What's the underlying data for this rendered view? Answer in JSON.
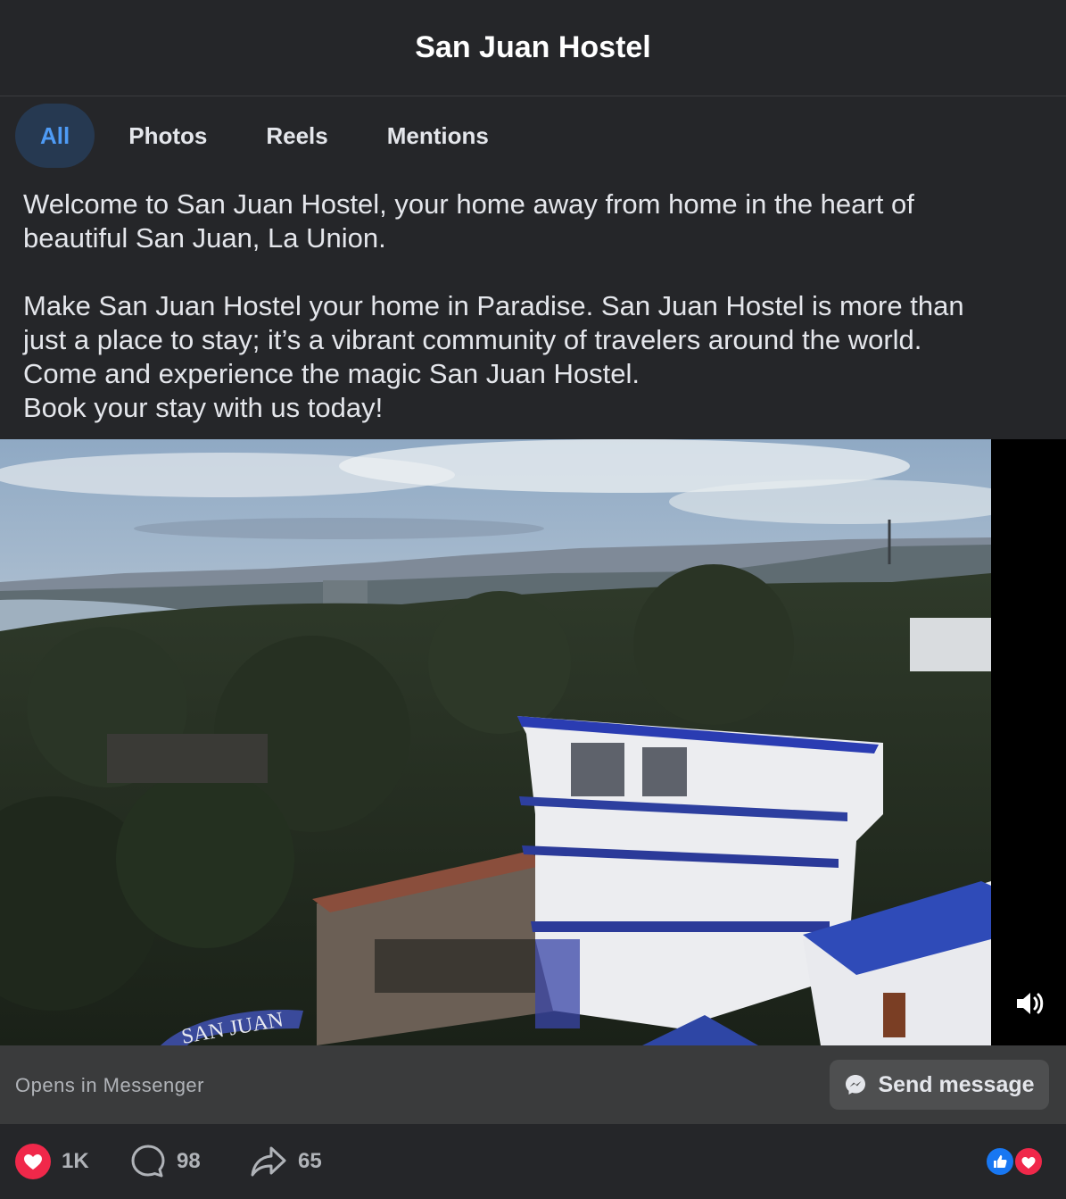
{
  "header": {
    "title": "San Juan Hostel"
  },
  "tabs": [
    {
      "label": "All",
      "active": true
    },
    {
      "label": "Photos",
      "active": false
    },
    {
      "label": "Reels",
      "active": false
    },
    {
      "label": "Mentions",
      "active": false
    }
  ],
  "description": {
    "paragraph1": [
      "Welcome to San Juan Hostel, your home away from home in the heart of",
      "beautiful San Juan, La Union."
    ],
    "paragraph2": [
      "Make San Juan Hostel your home in Paradise. San Juan Hostel is more than",
      "just a place to stay; it’s a vibrant community of travelers around the world.",
      "Come and experience the magic San Juan Hostel.",
      "Book your stay with us today!"
    ]
  },
  "media": {
    "type": "video",
    "sign_text": "SAN JUAN",
    "volume_icon": "speaker-icon"
  },
  "cta": {
    "label": "Opens in Messenger",
    "button_label": "Send message",
    "button_icon": "messenger-icon"
  },
  "engagement": {
    "likes": "1K",
    "comments": "98",
    "shares": "65",
    "reaction_icons": [
      "like-icon",
      "love-icon"
    ]
  },
  "colors": {
    "background": "#252629",
    "active_tab_bg": "#263951",
    "active_tab_text": "#4e9bf5",
    "love_red": "#f0284a",
    "like_blue": "#1877f2"
  }
}
